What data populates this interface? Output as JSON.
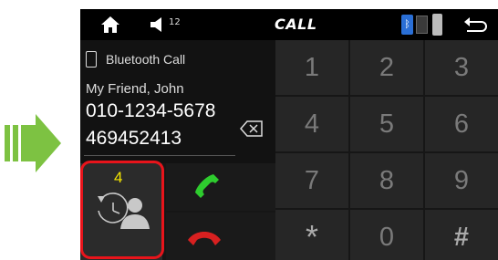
{
  "topbar": {
    "title": "CALL",
    "volume_level": "12",
    "icons": [
      "home-icon",
      "volume-icon",
      "bluetooth-icon",
      "accessory-icon",
      "usb-icon",
      "back-icon"
    ]
  },
  "call_info": {
    "source_label": "Bluetooth Call",
    "contact_name": "My Friend, John",
    "contact_number": "010-1234-5678",
    "dialed_digits": "469452413"
  },
  "history": {
    "count": "4"
  },
  "keypad": {
    "keys": [
      "1",
      "2",
      "3",
      "4",
      "5",
      "6",
      "7",
      "8",
      "9",
      "*",
      "0",
      "#"
    ]
  },
  "colors": {
    "highlight": "#e8141b",
    "arrow": "#7dc242",
    "call_green": "#2ecc2e",
    "end_red": "#d82020",
    "history_count": "#f5e600"
  }
}
